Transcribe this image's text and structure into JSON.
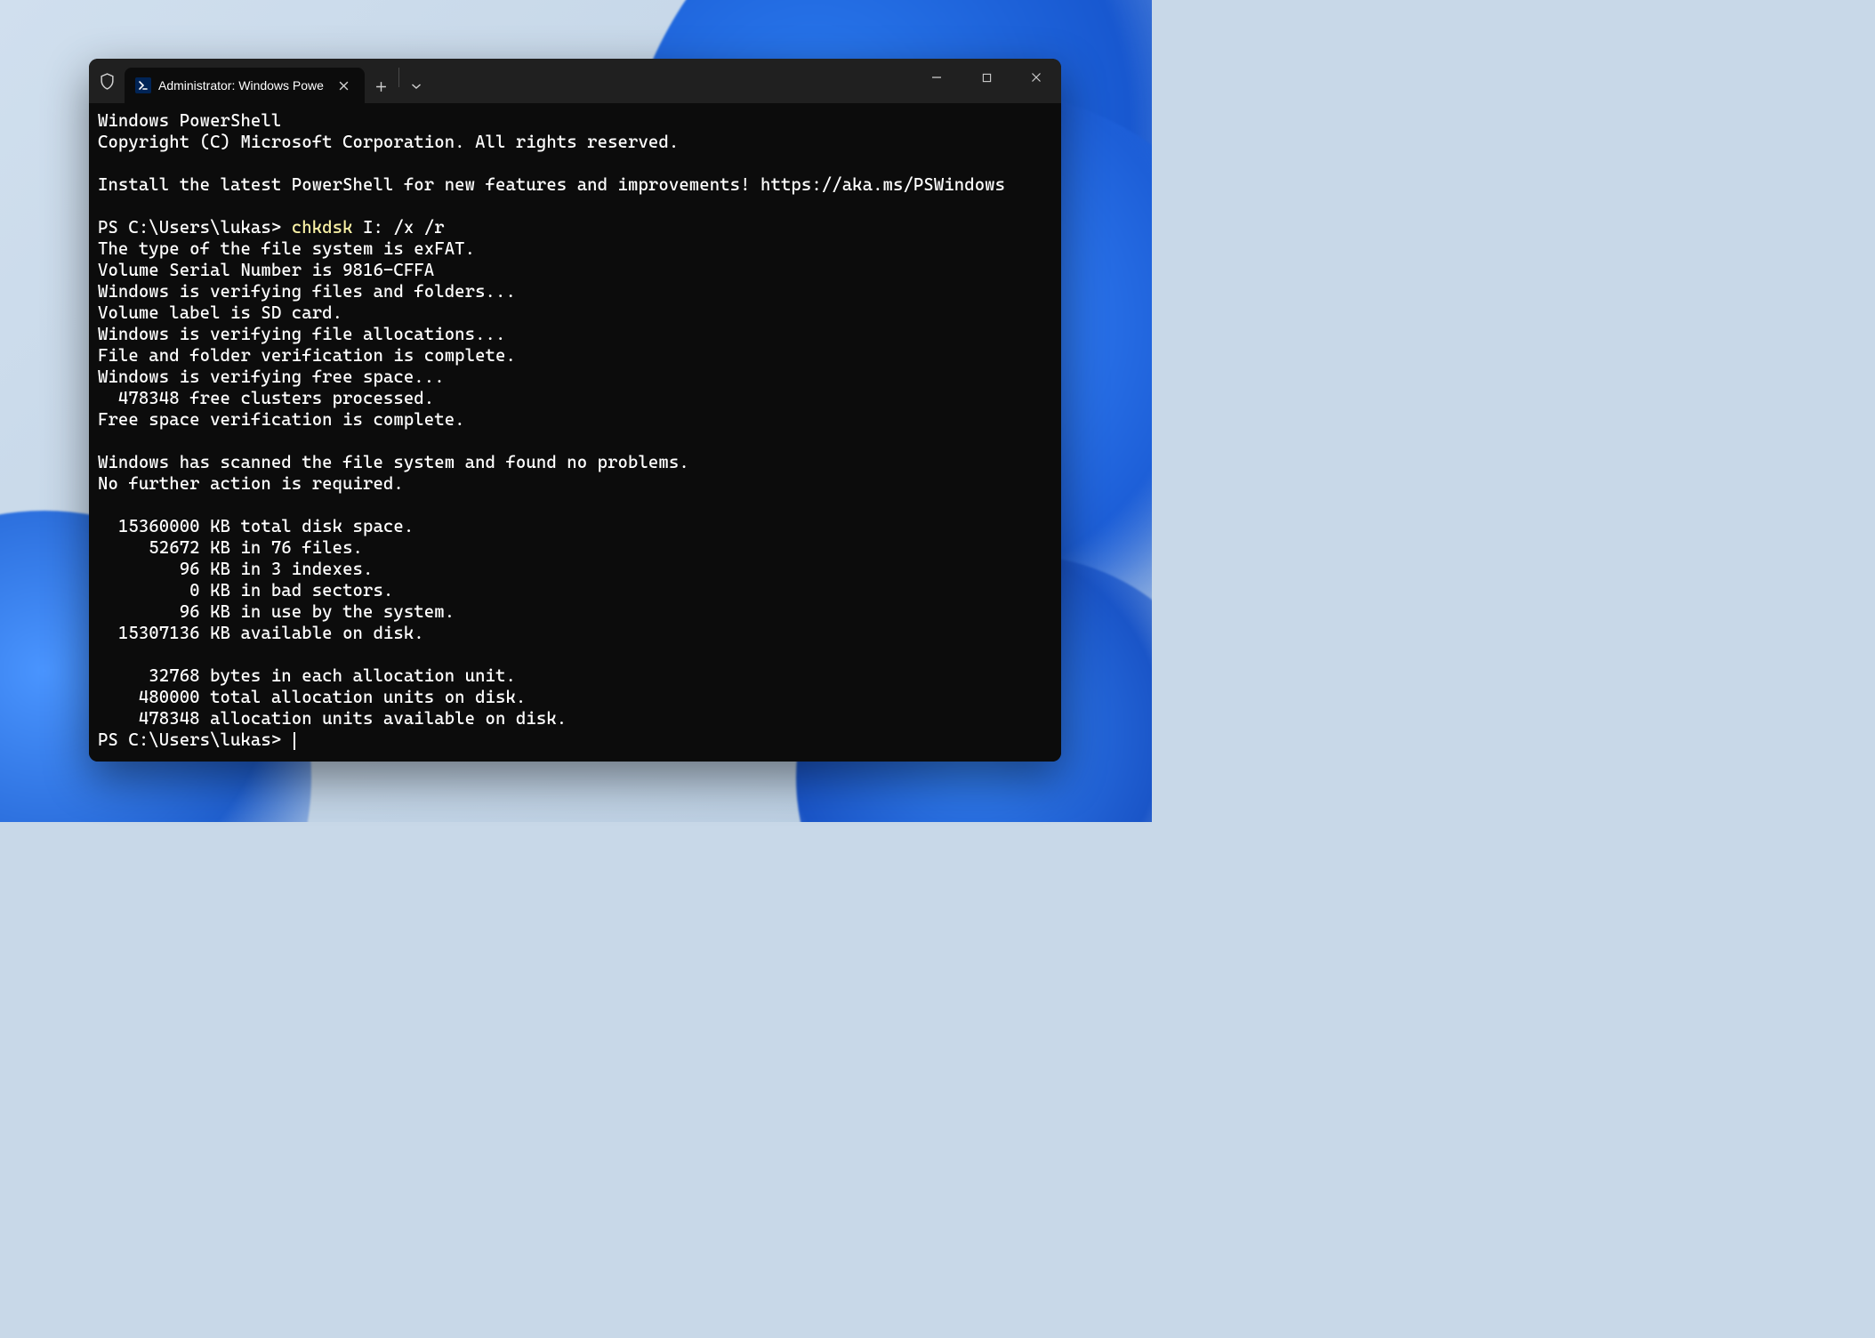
{
  "tab": {
    "title": "Administrator: Windows Powe"
  },
  "terminal": {
    "header1": "Windows PowerShell",
    "header2": "Copyright (C) Microsoft Corporation. All rights reserved.",
    "install_msg": "Install the latest PowerShell for new features and improvements! https://aka.ms/PSWindows",
    "prompt1_prefix": "PS C:\\Users\\lukas> ",
    "prompt1_cmd": "chkdsk",
    "prompt1_args": " I: /x /r",
    "out1": "The type of the file system is exFAT.",
    "out2": "Volume Serial Number is 9816-CFFA",
    "out3": "Windows is verifying files and folders...",
    "out4": "Volume label is SD card.",
    "out5": "Windows is verifying file allocations...",
    "out6": "File and folder verification is complete.",
    "out7": "Windows is verifying free space...",
    "out8": "  478348 free clusters processed.",
    "out9": "Free space verification is complete.",
    "out10": "Windows has scanned the file system and found no problems.",
    "out11": "No further action is required.",
    "s1": "  15360000 KB total disk space.",
    "s2": "     52672 KB in 76 files.",
    "s3": "        96 KB in 3 indexes.",
    "s4": "         0 KB in bad sectors.",
    "s5": "        96 KB in use by the system.",
    "s6": "  15307136 KB available on disk.",
    "a1": "     32768 bytes in each allocation unit.",
    "a2": "    480000 total allocation units on disk.",
    "a3": "    478348 allocation units available on disk.",
    "prompt2": "PS C:\\Users\\lukas> "
  }
}
